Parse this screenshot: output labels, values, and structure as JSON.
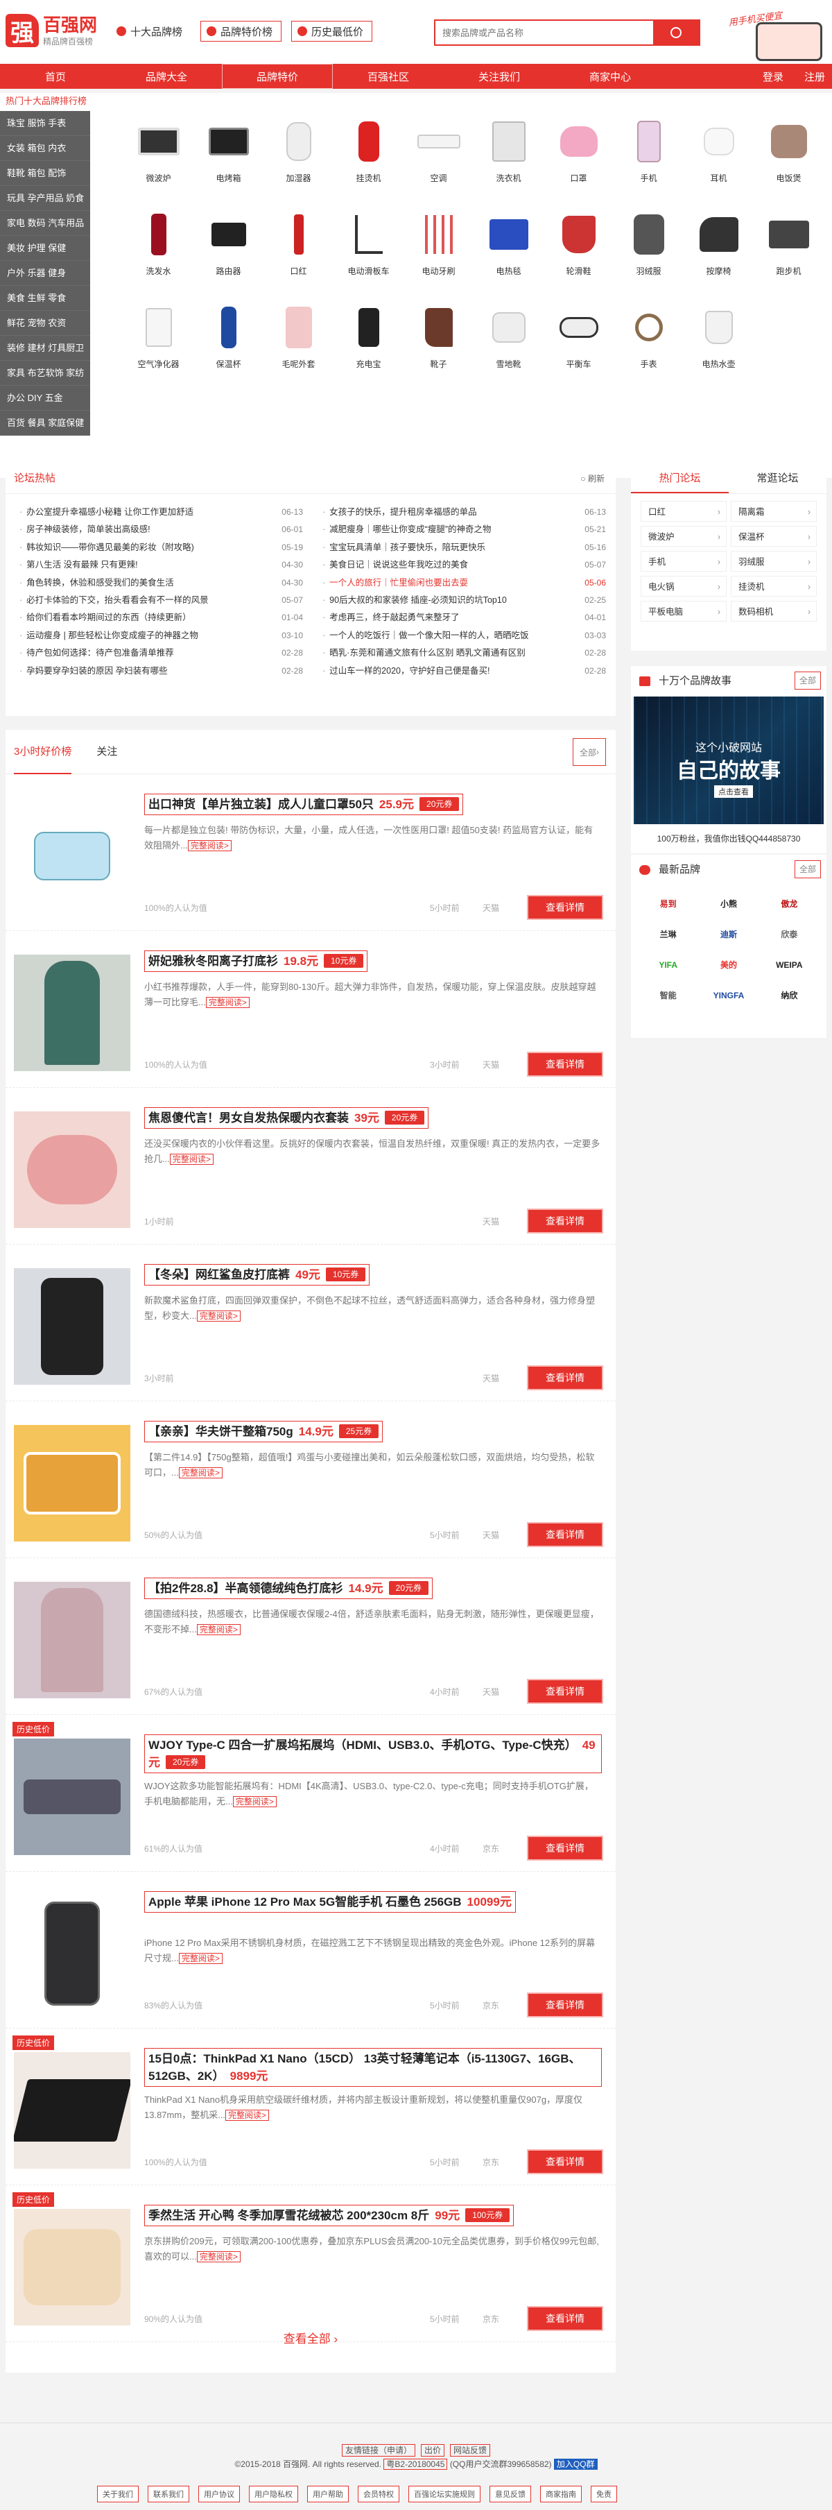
{
  "header": {
    "logo_mark": "强",
    "logo_name": "百强网",
    "logo_slogan": "精品牌百强榜",
    "link1": "十大品牌榜",
    "link2": "品牌特价榜",
    "link3": "历史最低价",
    "search_placeholder": "搜索品牌或产品名称",
    "app_promo": "用手机买便宜"
  },
  "nav": {
    "items": [
      "首页",
      "品牌大全",
      "品牌特价",
      "百强社区",
      "关注我们",
      "商家中心"
    ],
    "login": "登录",
    "register": "注册"
  },
  "hot_brand_bar": "热门十大品牌排行榜",
  "categories": [
    "珠宝 服饰 手表",
    "女装 箱包 内衣",
    "鞋靴 箱包 配饰",
    "玩具 孕产用品 奶食",
    "家电 数码 汽车用品",
    "美妆 护理 保健",
    "户外 乐器 健身",
    "美食 生鲜 零食",
    "鲜花 宠物 农资",
    "装修 建材 灯具厨卫",
    "家具 布艺软饰 家纺",
    "办公 DIY 五金",
    "百货 餐具 家庭保健"
  ],
  "products": [
    "微波炉",
    "电烤箱",
    "加湿器",
    "挂烫机",
    "空调",
    "洗衣机",
    "口罩",
    "手机",
    "耳机",
    "电饭煲",
    "洗发水",
    "路由器",
    "口红",
    "电动滑板车",
    "电动牙刷",
    "电热毯",
    "轮滑鞋",
    "羽绒服",
    "按摩椅",
    "跑步机",
    "空气净化器",
    "保温杯",
    "毛呢外套",
    "充电宝",
    "靴子",
    "雪地靴",
    "平衡车",
    "手表",
    "电热水壶"
  ],
  "forum": {
    "title": "论坛热帖",
    "refresh": "刷新",
    "left": [
      {
        "t": "办公室提升幸福感小秘籍 让你工作更加舒适",
        "d": "06-13"
      },
      {
        "t": "房子神级装修，简单装出高级感!",
        "d": "06-01"
      },
      {
        "t": "韩妆知识——带你遇见最美的彩妆（附攻略)",
        "d": "05-19"
      },
      {
        "t": "第八生活 没有最辣 只有更辣!",
        "d": "04-30"
      },
      {
        "t": "角色转换，休验和感受我们的美食生活",
        "d": "04-30"
      },
      {
        "t": "必打卡体验的下交，抬头看看会有不一样的风景",
        "d": "05-07"
      },
      {
        "t": "给你们看看本吟期间过的东西（持续更新）",
        "d": "01-04"
      },
      {
        "t": "运动瘦身 | 那些轻松让你变成瘦子的神器之物",
        "d": "03-10"
      },
      {
        "t": "待产包如何选择：待产包准备清单推荐",
        "d": "02-28"
      },
      {
        "t": "孕妈要穿孕妇装的原因 孕妇装有哪些",
        "d": "02-28"
      }
    ],
    "right": [
      {
        "t": "女孩子的快乐，提升租房幸福感的单品",
        "d": "06-13",
        "hot": false
      },
      {
        "t": "减肥瘦身｜哪些让你变成“瘦腿”的神奇之物",
        "d": "05-21",
        "hot": false
      },
      {
        "t": "宝宝玩具清单｜孩子要快乐，陪玩更快乐",
        "d": "05-16",
        "hot": false
      },
      {
        "t": "美食日记｜说说这些年我吃过的美食",
        "d": "05-07",
        "hot": false
      },
      {
        "t": "一个人的旅行｜忙里偷闲也要出去耍",
        "d": "05-06",
        "hot": true
      },
      {
        "t": "90后大叔的和家装修 插座-必须知识的坑Top10",
        "d": "02-25",
        "hot": false
      },
      {
        "t": "考虑再三，终于敲起勇气来整牙了",
        "d": "04-01",
        "hot": false
      },
      {
        "t": "一个人的吃饭行｜做一个像大阳一样的人，晒晒吃饭",
        "d": "03-03",
        "hot": false
      },
      {
        "t": "晒乳·东莞和莆通文旅有什么区别 晒乳文莆通有区别",
        "d": "02-28",
        "hot": false
      },
      {
        "t": "过山车一样的2020，守护好自己便是备买!",
        "d": "02-28",
        "hot": false
      }
    ]
  },
  "hot_forums": {
    "tab1": "热门论坛",
    "tab2": "常逛论坛",
    "items": [
      "口红",
      "隔离霜",
      "微波炉",
      "保温杯",
      "手机",
      "羽绒服",
      "电火锅",
      "挂烫机",
      "平板电脑",
      "数码相机"
    ]
  },
  "stories": {
    "title": "十万个品牌故事",
    "more": "全部",
    "banner_line1": "这个小破网站",
    "banner_line2": "自己的故事",
    "banner_btn": "点击查看",
    "caption": "100万粉丝，我值你出钱QQ444858730"
  },
  "newbrands": {
    "title": "最新品牌",
    "more": "全部",
    "logos": [
      "易到",
      "小熊",
      "傲龙",
      "兰琳",
      "迪斯",
      "欣泰",
      "YIFA",
      "美的",
      "WEIPA",
      "智能",
      "YINGFA",
      "纳欣"
    ]
  },
  "deals": {
    "tabs": [
      "3小时好价榜",
      "关注"
    ],
    "all": "全部",
    "see_all": "查看全部",
    "items": [
      {
        "title": "出口神货【单片独立装】成人儿童口罩50只",
        "price": "25.9元",
        "coupon": "20元券",
        "desc": "每一片都是独立包装! 带防伪标识，大量，小量，成人任选，一次性医用口罩! 超值50支装! 药监局官方认证，能有效阻隔外...",
        "more": "完整阅读>",
        "meta": "100%的人认为值",
        "time": "5小时前",
        "store": "天猫",
        "btn": "查看详情",
        "hist": ""
      },
      {
        "title": "妍妃雅秋冬阳离子打底衫",
        "price": "19.8元",
        "coupon": "10元券",
        "desc": "小红书推荐爆款，人手一件，能穿到80-130斤。超大弹力非饰件，自发热，保暖功能，穿上保温皮肤。皮肤越穿越薄一可比穿毛...",
        "more": "完整阅读>",
        "meta": "100%的人认为值",
        "time": "3小时前",
        "store": "天猫",
        "btn": "查看详情",
        "hist": ""
      },
      {
        "title": "焦恩傻代言！男女自发热保暖内衣套装",
        "price": "39元",
        "coupon": "20元券",
        "desc": "还没买保暖内衣的小伙伴看这里。反挑好的保暖内衣套装，恒温自发热纤维，双重保暖! 真正的发热内衣，一定要多抢几...",
        "more": "完整阅读>",
        "meta": "1小时前",
        "time": "",
        "store": "天猫",
        "btn": "查看详情",
        "hist": ""
      },
      {
        "title": "【冬朵】网红鲨鱼皮打底裤",
        "price": "49元",
        "coupon": "10元券",
        "desc": "新款魔术鲨鱼打底，四面回弹双重保护，不倒色不起球不拉丝，透气舒适面料高弹力，适合各种身材，强力修身塑型，秒变大...",
        "more": "完整阅读>",
        "meta": "3小时前",
        "time": "",
        "store": "天猫",
        "btn": "查看详情",
        "hist": ""
      },
      {
        "title": "【亲亲】华夫饼干整箱750g",
        "price": "14.9元",
        "coupon": "25元券",
        "desc": "【第二件14.9】【750g整箱，超值哦!】鸡蛋与小麦碰撞出美和，如云朵般蓬松软口感，双面烘焙，均匀受热，松软可口，...",
        "more": "完整阅读>",
        "meta": "50%的人认为值",
        "time": "5小时前",
        "store": "天猫",
        "btn": "查看详情",
        "hist": ""
      },
      {
        "title": "【拍2件28.8】半高领德绒纯色打底衫",
        "price": "14.9元",
        "coupon": "20元券",
        "desc": "德国德绒科技，热感暖衣，比普通保暖衣保暖2-4倍，舒适亲肤素毛面料，贴身无刺激，随形弹性，更保暖更显瘦，不变形不掉...",
        "more": "完整阅读>",
        "meta": "67%的人认为值",
        "time": "4小时前",
        "store": "天猫",
        "btn": "查看详情",
        "hist": ""
      },
      {
        "title": "WJOY Type-C 四合一扩展坞拓展坞（HDMI、USB3.0、手机OTG、Type-C快充）",
        "price": "49元",
        "coupon": "20元券",
        "desc": "WJOY这款多功能智能拓展坞有：HDMI【4K高清】、USB3.0、type-C2.0、type-c充电；同时支持手机OTG扩展，手机电脑都能用，无...",
        "more": "完整阅读>",
        "meta": "61%的人认为值",
        "time": "4小时前",
        "store": "京东",
        "btn": "查看详情",
        "hist": "历史低价"
      },
      {
        "title": "Apple 苹果 iPhone 12 Pro Max 5G智能手机 石墨色 256GB",
        "price": "10099元",
        "coupon": "",
        "desc": "iPhone 12 Pro Max采用不锈钢机身材质，在磁控溅工艺下不锈钢呈现出精致的亮金色外观。iPhone 12系列的屏幕尺寸规...",
        "more": "完整阅读>",
        "meta": "83%的人认为值",
        "time": "5小时前",
        "store": "京东",
        "btn": "查看详情",
        "hist": ""
      },
      {
        "title": "15日0点：ThinkPad X1 Nano（15CD） 13英寸轻薄笔记本（i5-1130G7、16GB、512GB、2K）",
        "price": "9899元",
        "coupon": "",
        "desc": "ThinkPad X1 Nano机身采用航空级碳纤维材质，并将内部主板设计重新规划，将以使整机重量仅907g，厚度仅13.87mm，整机采...",
        "more": "完整阅读>",
        "meta": "100%的人认为值",
        "time": "5小时前",
        "store": "京东",
        "btn": "查看详情",
        "hist": "历史低价"
      },
      {
        "title": "季然生活 开心鸭 冬季加厚雪花绒被芯 200*230cm 8斤",
        "price": "99元",
        "coupon": "100元券",
        "desc": "京东拼购价209元，可领取满200-100优惠券，叠加京东PLUS会员满200-10元全品类优惠券，到手价格仅99元包邮,喜欢的可以...",
        "more": "完整阅读>",
        "meta": "90%的人认为值",
        "time": "5小时前",
        "store": "京东",
        "btn": "查看详情",
        "hist": "历史低价"
      }
    ]
  },
  "footer": {
    "row1": [
      "友情链接（申请）",
      "出价",
      "网站反馈"
    ],
    "copyright": "©2015-2018 百强网. All rights reserved.",
    "icp": "粤B2-20180045",
    "qq": "(QQ用户交流群399658582)",
    "qq_btn": "加入QQ群",
    "links": [
      "关于我们",
      "联系我们",
      "用户协议",
      "用户隐私权",
      "用户帮助",
      "会员特权",
      "百强论坛实施规则",
      "意见反馈",
      "商家指南",
      "免责"
    ]
  }
}
